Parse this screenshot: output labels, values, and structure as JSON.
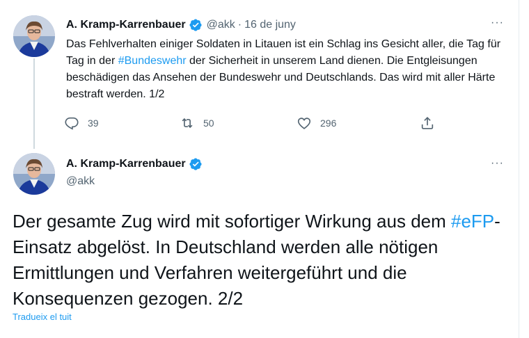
{
  "tweet1": {
    "author": "A. Kramp-Karrenbauer",
    "handle": "@akk",
    "separator": "·",
    "date": "16 de juny",
    "text_parts": [
      "Das Fehlverhalten einiger Soldaten in Litauen ist ein Schlag ins Gesicht aller, die Tag für Tag in der ",
      "#Bundeswehr",
      " der Sicherheit in unserem Land dienen. Die Entgleisungen beschädigen das Ansehen der Bundeswehr und Deutschlands. Das wird mit aller Härte bestraft werden. 1/2"
    ],
    "replies": "39",
    "retweets": "50",
    "likes": "296",
    "more": "···"
  },
  "tweet2": {
    "author": "A. Kramp-Karrenbauer",
    "handle": "@akk",
    "text_parts": [
      "Der gesamte Zug wird mit sofortiger Wirkung aus dem ",
      "#eFP",
      "-Einsatz abgelöst. In Deutschland werden alle nötigen Ermittlungen und Verfahren weitergeführt und die Konsequenzen gezogen. 2/2"
    ],
    "translate_label": "Tradueix el tuit",
    "more": "···"
  },
  "icons": [
    "avatar",
    "verified-badge-icon",
    "reply-icon",
    "retweet-icon",
    "like-icon",
    "share-icon",
    "more-icon"
  ],
  "colors": {
    "accent": "#1d9bf0",
    "secondary_text": "#536471",
    "text": "#0f1419",
    "thread_line": "#cfd9de"
  }
}
